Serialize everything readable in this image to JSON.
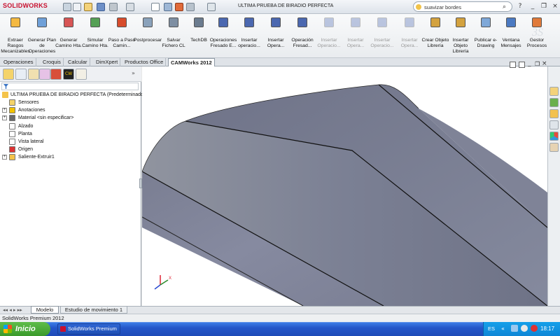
{
  "window": {
    "app_logo": "SOLIDWORKS",
    "title": "ULTIMA PRUEBA DE BIRADIO PERFECTA",
    "search_value": "suavizar bordes"
  },
  "ribbon": {
    "buttons": [
      {
        "label": "Extraer Rasgos Mecanizables",
        "icon": "extract-features-icon",
        "enabled": true
      },
      {
        "label": "Generar Plan de Operaciones",
        "icon": "generate-plan-icon",
        "enabled": true
      },
      {
        "label": "Generar Camino Hta.",
        "icon": "generate-toolpath-icon",
        "enabled": true
      },
      {
        "label": "Simular Camino Hta.",
        "icon": "simulate-toolpath-icon",
        "enabled": true
      },
      {
        "label": "Paso a Paso Camin...",
        "icon": "step-through-icon",
        "enabled": true
      },
      {
        "label": "Postprocesar",
        "icon": "postprocess-icon",
        "enabled": true
      },
      {
        "label": "Salvar Fichero CL",
        "icon": "save-cl-icon",
        "enabled": true
      },
      {
        "label": "TechDB",
        "icon": "techdb-icon",
        "enabled": true
      },
      {
        "label": "Operaciones Fresado E...",
        "icon": "mill-operations-icon",
        "enabled": true
      },
      {
        "label": "Insertar operacio...",
        "icon": "insert-operation-icon",
        "enabled": true
      },
      {
        "label": "Insertar Opera...",
        "icon": "insert-operation-icon",
        "enabled": true
      },
      {
        "label": "Operación Fresad...",
        "icon": "mill-operation-icon",
        "enabled": true
      },
      {
        "label": "Insertar Operacio...",
        "icon": "insert-operation-icon",
        "enabled": false
      },
      {
        "label": "Insertar Opera...",
        "icon": "insert-operation-icon",
        "enabled": false
      },
      {
        "label": "Insertar Operacio...",
        "icon": "insert-operation-icon",
        "enabled": false
      },
      {
        "label": "Insertar Opera...",
        "icon": "insert-operation-icon",
        "enabled": false
      },
      {
        "label": "Crear Objeto Librería",
        "icon": "create-library-object-icon",
        "enabled": true
      },
      {
        "label": "Insertar Objeto Librería",
        "icon": "insert-library-object-icon",
        "enabled": true
      },
      {
        "label": "Publicar e-Drawing",
        "icon": "publish-edrawing-icon",
        "enabled": true
      },
      {
        "label": "Ventana Mensajes",
        "icon": "message-window-icon",
        "enabled": true
      },
      {
        "label": "Gestor Procesos",
        "icon": "process-manager-icon",
        "enabled": true
      }
    ]
  },
  "tabs": [
    "Operaciones",
    "Croquis",
    "Calcular",
    "DimXpert",
    "Productos Office",
    "CAMWorks 2012"
  ],
  "active_tab": "CAMWorks 2012",
  "tree": {
    "root": "ULTIMA PRUEBA DE BIRADIO PERFECTA  (Predeterminado<<",
    "items": [
      {
        "label": "Sensores",
        "icon": "sensors-icon"
      },
      {
        "label": "Anotaciones",
        "icon": "annotations-icon"
      },
      {
        "label": "Material <sin especificar>",
        "icon": "material-icon"
      },
      {
        "label": "Alzado",
        "icon": "plane-icon"
      },
      {
        "label": "Planta",
        "icon": "plane-icon"
      },
      {
        "label": "Vista lateral",
        "icon": "plane-icon"
      },
      {
        "label": "Origen",
        "icon": "origin-icon"
      },
      {
        "label": "Saliente-Extruir1",
        "icon": "extrude-icon"
      }
    ]
  },
  "bottom_tabs": [
    "Modelo",
    "Estudio de movimiento 1"
  ],
  "status_text": "SolidWorks Premium 2012",
  "taskbar": {
    "start_label": "Inicio",
    "task_label": "SolidWorks Premium 2...",
    "language": "ES",
    "clock": "18:17"
  },
  "colors": {
    "model_face": "#7d8196",
    "model_edge": "#1a1a1a",
    "accent": "#c8102e"
  }
}
